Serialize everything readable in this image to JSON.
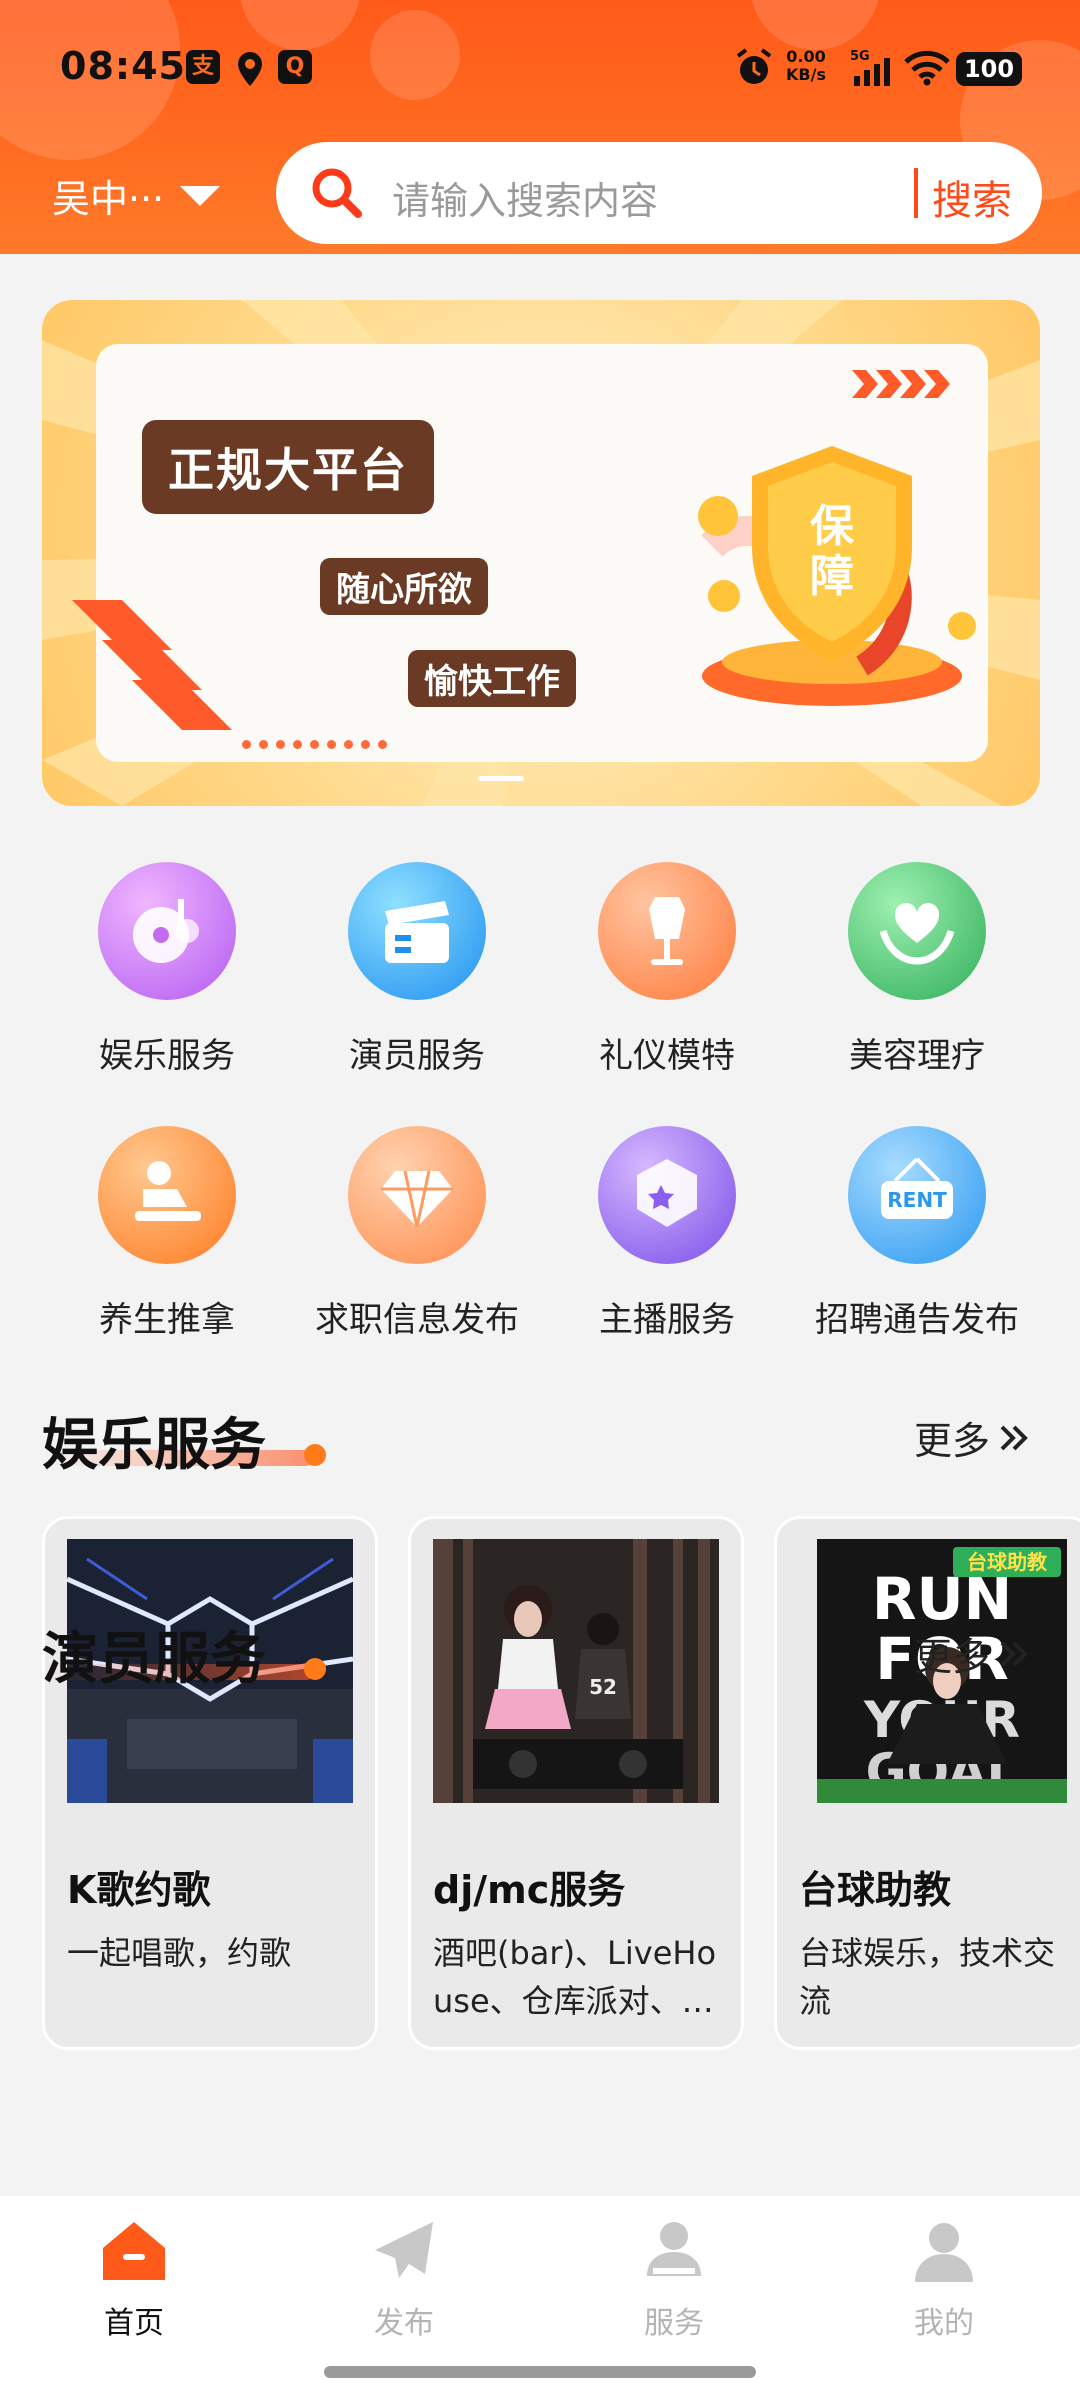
{
  "status_bar": {
    "time": "08:45",
    "net_speed": "0.00",
    "net_unit": "KB/s",
    "network": "5G",
    "battery": "100"
  },
  "header": {
    "location": "吴中···",
    "search_placeholder": "请输入搜索内容",
    "search_button": "搜索"
  },
  "banner": {
    "title": "正规大平台",
    "tag1": "随心所欲",
    "tag2": "愉快工作",
    "shield_text": "保障"
  },
  "categories": [
    {
      "label": "娱乐服务",
      "icon": "music-disc-icon",
      "color": "#c46cf0"
    },
    {
      "label": "演员服务",
      "icon": "clapperboard-icon",
      "color": "#2fa4f5"
    },
    {
      "label": "礼仪模特",
      "icon": "mannequin-icon",
      "color": "#ff8a4a"
    },
    {
      "label": "美容理疗",
      "icon": "heart-hands-icon",
      "color": "#3fbf6a"
    },
    {
      "label": "养生推拿",
      "icon": "massage-icon",
      "color": "#ff8c30"
    },
    {
      "label": "求职信息发布",
      "icon": "diamond-icon",
      "color": "#ff9a60"
    },
    {
      "label": "主播服务",
      "icon": "star-badge-icon",
      "color": "#9a6ef0"
    },
    {
      "label": "招聘通告发布",
      "icon": "rent-sign-icon",
      "color": "#38a8f4"
    }
  ],
  "sections": [
    {
      "title": "娱乐服务",
      "more": "更多"
    },
    {
      "title": "演员服务",
      "more": "更多"
    }
  ],
  "cards": [
    {
      "title": "K歌约歌",
      "desc": "一起唱歌，约歌"
    },
    {
      "title": "dj/mc服务",
      "desc": "酒吧(bar)、LiveHouse、仓库派对、…"
    },
    {
      "title": "台球助教",
      "desc": "台球娱乐，技术交流",
      "poster_text": "RUN FOR YOUR GOAL",
      "poster_badge": "台球助教"
    }
  ],
  "nav": [
    {
      "label": "首页",
      "active": true
    },
    {
      "label": "发布",
      "active": false
    },
    {
      "label": "服务",
      "active": false
    },
    {
      "label": "我的",
      "active": false
    }
  ],
  "colors": {
    "brand": "#ff5a1a",
    "accent": "#ff7a18"
  }
}
